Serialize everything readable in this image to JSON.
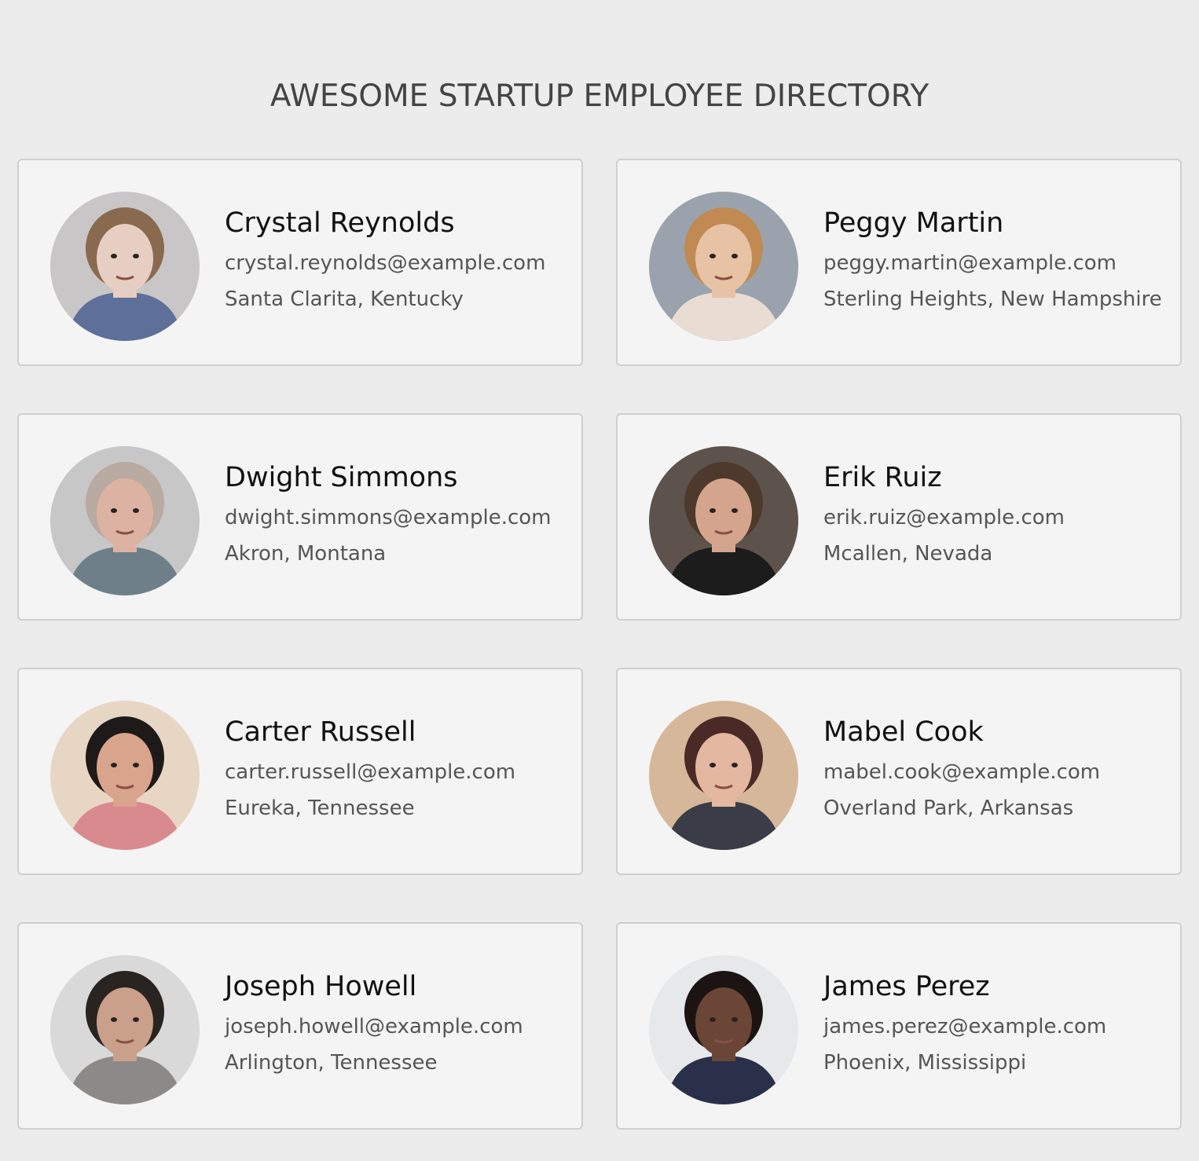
{
  "header": {
    "title": "AWESOME STARTUP EMPLOYEE DIRECTORY"
  },
  "employees": [
    {
      "name": "Crystal Reynolds",
      "email": "crystal.reynolds@example.com",
      "location": "Santa Clarita, Kentucky",
      "avatar": {
        "bg": "#c9c6c8",
        "skin": "#e6cfc2",
        "hair": "#8a6a4e",
        "shirt": "#5e6f9a"
      }
    },
    {
      "name": "Peggy Martin",
      "email": "peggy.martin@example.com",
      "location": "Sterling Heights, New Hampshire",
      "avatar": {
        "bg": "#9aa3ad",
        "skin": "#e8c2a4",
        "hair": "#c08a52",
        "shirt": "#e9ddd3"
      }
    },
    {
      "name": "Dwight Simmons",
      "email": "dwight.simmons@example.com",
      "location": "Akron, Montana",
      "avatar": {
        "bg": "#c7c7c7",
        "skin": "#dcb3a2",
        "hair": "#b9aaa2",
        "shirt": "#6f7f89"
      }
    },
    {
      "name": "Erik Ruiz",
      "email": "erik.ruiz@example.com",
      "location": "Mcallen, Nevada",
      "avatar": {
        "bg": "#5e534c",
        "skin": "#d4a58c",
        "hair": "#4d3a2d",
        "shirt": "#1c1c1c"
      }
    },
    {
      "name": "Carter Russell",
      "email": "carter.russell@example.com",
      "location": "Eureka, Tennessee",
      "avatar": {
        "bg": "#e8d6c4",
        "skin": "#d9a48c",
        "hair": "#1e1a1a",
        "shirt": "#d98a8e"
      }
    },
    {
      "name": "Mabel Cook",
      "email": "mabel.cook@example.com",
      "location": "Overland Park, Arkansas",
      "avatar": {
        "bg": "#d6b79a",
        "skin": "#e3b7a0",
        "hair": "#4a2a26",
        "shirt": "#3a3d48"
      }
    },
    {
      "name": "Joseph Howell",
      "email": "joseph.howell@example.com",
      "location": "Arlington, Tennessee",
      "avatar": {
        "bg": "#d9d9d9",
        "skin": "#caa08a",
        "hair": "#2a2420",
        "shirt": "#8c8a88"
      }
    },
    {
      "name": "James Perez",
      "email": "james.perez@example.com",
      "location": "Phoenix, Mississippi",
      "avatar": {
        "bg": "#e6e8ea",
        "skin": "#6b4636",
        "hair": "#1c1412",
        "shirt": "#2a2f4a"
      }
    }
  ]
}
